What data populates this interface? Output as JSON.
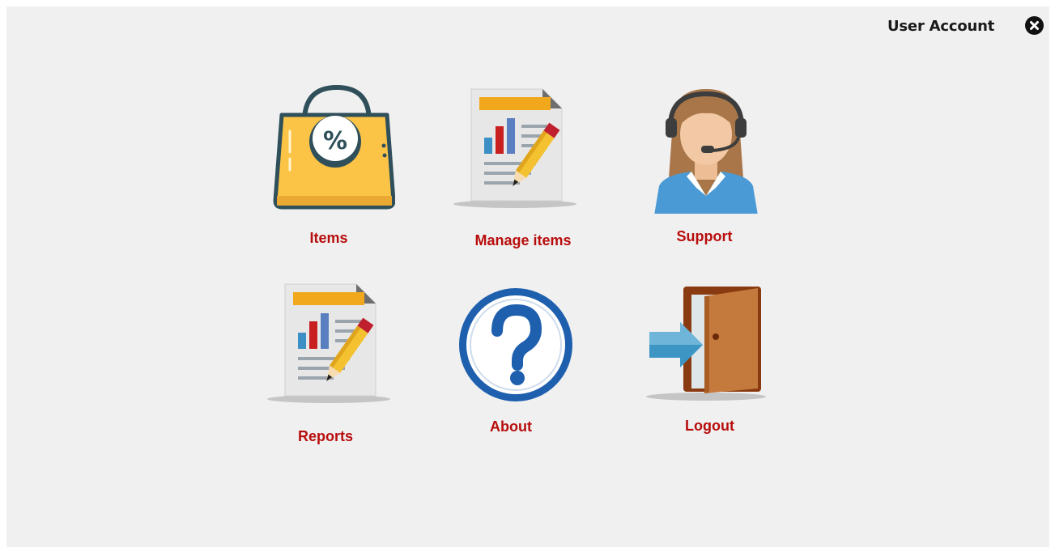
{
  "header": {
    "user_account_label": "User Account"
  },
  "icons": {
    "close": "close-icon",
    "items": "shopping-bag-percent-icon",
    "manage_items": "report-document-icon",
    "support": "support-agent-icon",
    "reports": "report-document-icon",
    "about": "question-mark-icon",
    "logout": "logout-door-icon"
  },
  "colors": {
    "label": "#b80d0d",
    "background": "#f0f0f0"
  },
  "menu": {
    "items": "Items",
    "manage_items": "Manage items",
    "support": "Support",
    "reports": "Reports",
    "about": "About",
    "logout": "Logout"
  }
}
